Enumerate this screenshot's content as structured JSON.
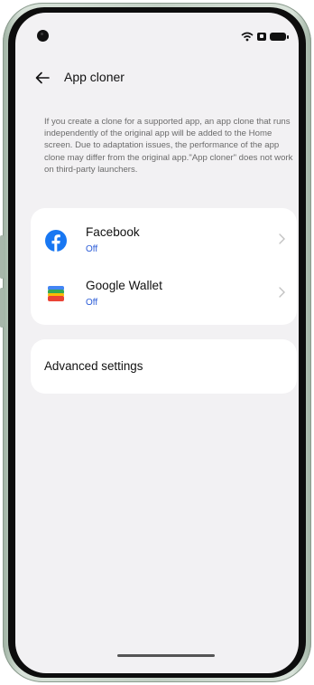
{
  "status_bar": {
    "icons": [
      "wifi-icon",
      "sim-icon",
      "battery-icon"
    ]
  },
  "header": {
    "back_icon": "arrow-left-icon",
    "title": "App cloner"
  },
  "description": "If you create a clone for a supported app, an app clone that runs independently of the original app will be added to the Home screen. Due to adaptation issues, the performance of the app clone may differ from the original app.\"App cloner\" does not work on third-party launchers.",
  "apps": [
    {
      "name": "Facebook",
      "status": "Off",
      "icon": "facebook-icon"
    },
    {
      "name": "Google Wallet",
      "status": "Off",
      "icon": "google-wallet-icon"
    }
  ],
  "advanced": {
    "label": "Advanced settings"
  },
  "colors": {
    "background": "#f2f1f3",
    "card": "#ffffff",
    "status_text": "#2a5bd7",
    "facebook_blue": "#1877f2"
  }
}
